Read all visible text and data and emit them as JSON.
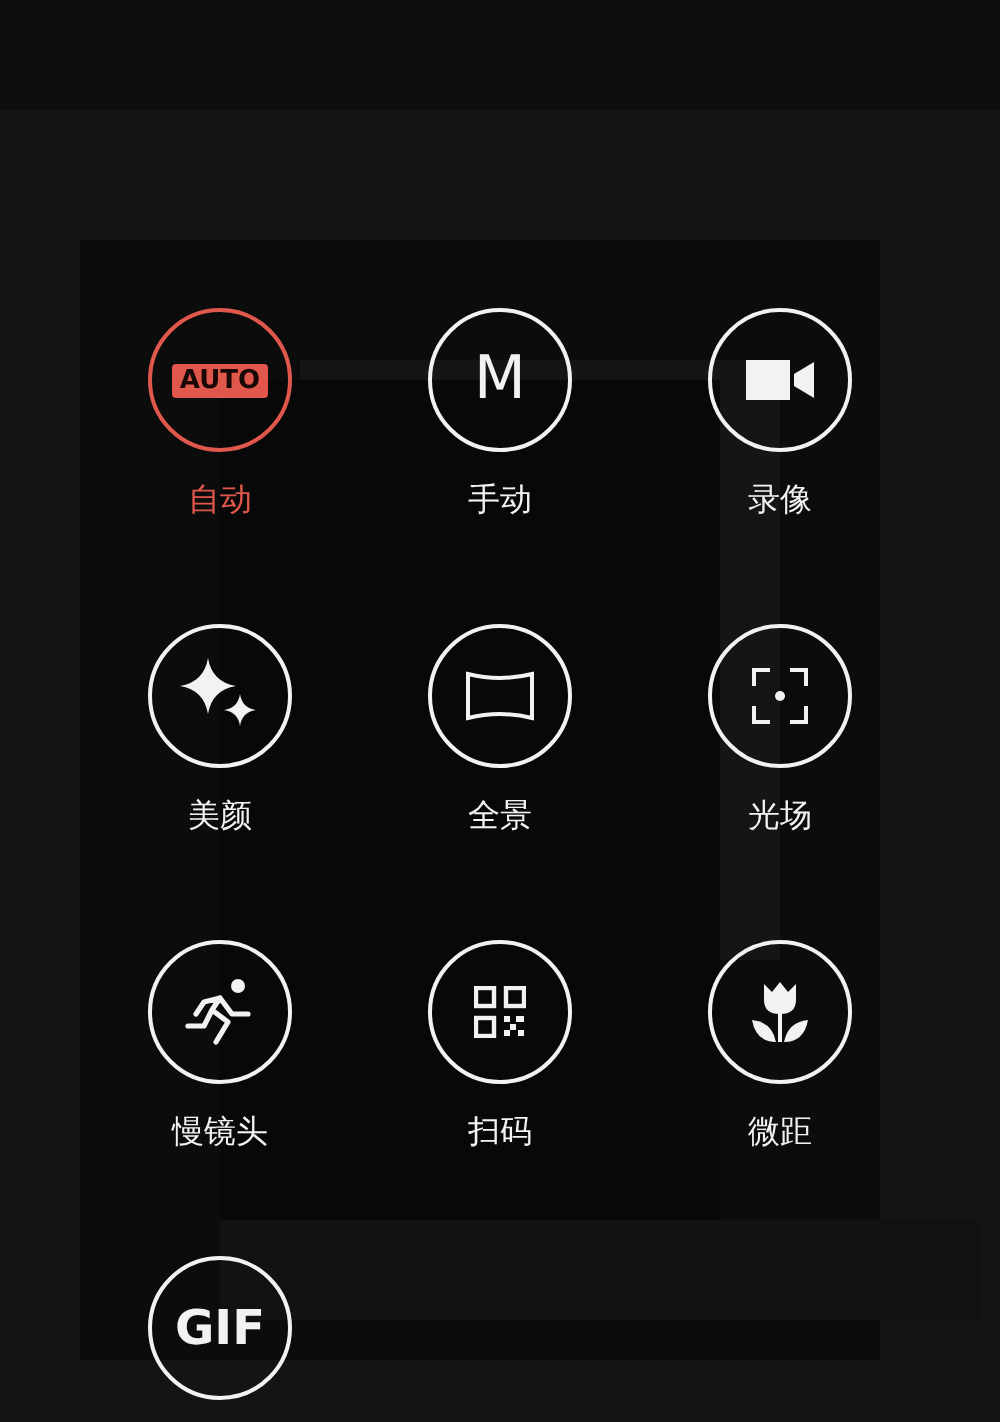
{
  "modes": [
    {
      "kind": "badge",
      "glyph": "AUTO",
      "label": "自动",
      "selected": true
    },
    {
      "kind": "letter",
      "glyph": "M",
      "label": "手动",
      "selected": false
    },
    {
      "kind": "video",
      "label": "录像",
      "selected": false
    },
    {
      "kind": "sparkle",
      "label": "美颜",
      "selected": false
    },
    {
      "kind": "panorama",
      "label": "全景",
      "selected": false
    },
    {
      "kind": "focus",
      "label": "光场",
      "selected": false
    },
    {
      "kind": "runner",
      "label": "慢镜头",
      "selected": false
    },
    {
      "kind": "qr",
      "label": "扫码",
      "selected": false
    },
    {
      "kind": "flower",
      "label": "微距",
      "selected": false
    },
    {
      "kind": "text",
      "glyph": "GIF",
      "selected": false
    }
  ]
}
